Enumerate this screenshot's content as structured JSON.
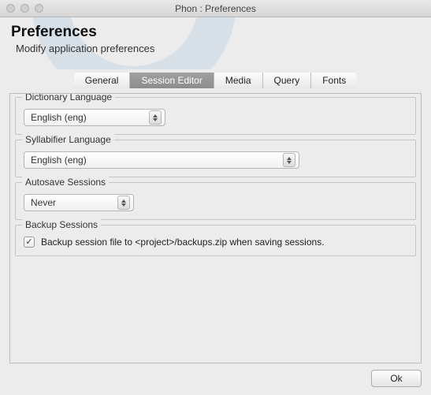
{
  "window": {
    "title": "Phon : Preferences"
  },
  "header": {
    "title": "Preferences",
    "subtitle": "Modify application preferences"
  },
  "tabs": {
    "items": [
      "General",
      "Session Editor",
      "Media",
      "Query",
      "Fonts"
    ],
    "active_index": 1
  },
  "groups": {
    "dictionary": {
      "title": "Dictionary Language",
      "value": "English (eng)"
    },
    "syllabifier": {
      "title": "Syllabifier Language",
      "value": "English (eng)"
    },
    "autosave": {
      "title": "Autosave Sessions",
      "value": "Never"
    },
    "backup": {
      "title": "Backup Sessions",
      "checkbox_checked": true,
      "checkbox_label": "Backup session file to <project>/backups.zip when saving sessions."
    }
  },
  "footer": {
    "ok_label": "Ok"
  }
}
